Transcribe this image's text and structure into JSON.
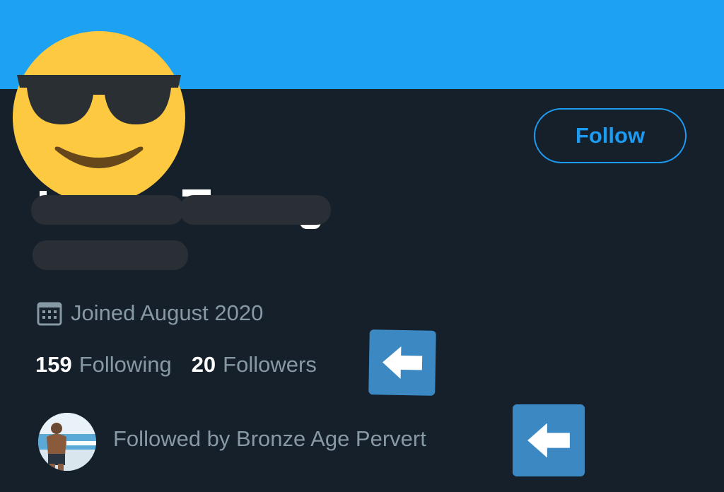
{
  "profile": {
    "follow_label": "Follow",
    "joined_text": "Joined August 2020",
    "following_count": "159",
    "following_label": "Following",
    "followers_count": "20",
    "followers_label": "Followers",
    "followed_by_text": "Followed by Bronze Age Pervert"
  },
  "icons": {
    "avatar": "sunglasses-face-emoji",
    "joined": "calendar-icon",
    "annotation": "left-arrow-emoji"
  },
  "colors": {
    "banner": "#1da1f2",
    "background": "#15202b",
    "accent": "#1d9bf0",
    "muted_text": "#8899a6",
    "redaction": "#2a2f36",
    "emoji_yellow": "#fcc940",
    "arrow_box": "#3b88c3"
  }
}
